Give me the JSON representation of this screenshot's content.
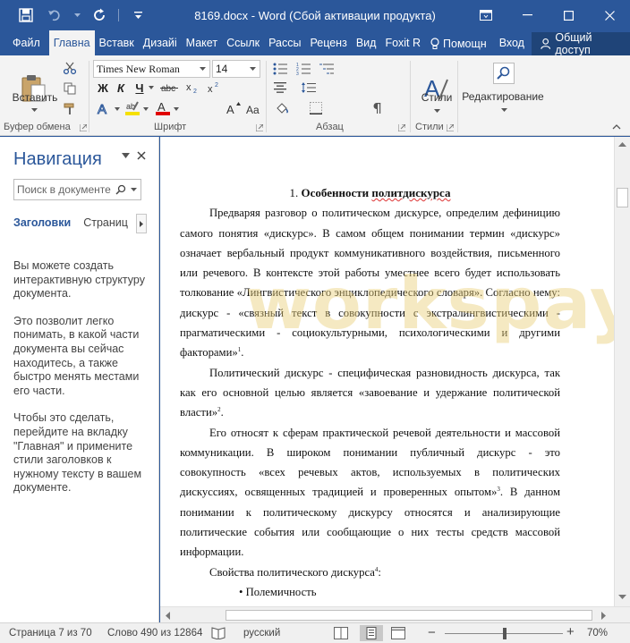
{
  "window": {
    "title": "8169.docx - Word (Сбой активации продукта)"
  },
  "tabs": {
    "file": "Файл",
    "items": [
      "Главна",
      "Вставк",
      "Дизайі",
      "Макет",
      "Ссылк",
      "Рассы",
      "Реценз",
      "Вид",
      "Foxit R"
    ],
    "help": "Помощн",
    "signin": "Вход",
    "share": "Общий доступ"
  },
  "ribbon": {
    "font_name": "Times New Roman",
    "font_size": "14",
    "paste_label": "Вставить",
    "styles_label": "Стили",
    "editing_label": "Редактирование",
    "groups": {
      "clipboard": "Буфер обмена",
      "font": "Шрифт",
      "paragraph": "Абзац",
      "styles": "Стили"
    },
    "format_buttons": [
      "Ж",
      "К",
      "Ч"
    ],
    "colors": {
      "highlight": "#f5e000",
      "font_color": "#e00000"
    }
  },
  "navigation": {
    "title": "Навигация",
    "search_placeholder": "Поиск в документе",
    "tab_headings": "Заголовки",
    "tab_pages": "Страниц",
    "help": [
      "Вы можете создать интерактивную структуру документа.",
      "Это позволит легко понимать, в какой части документа вы сейчас находитесь, а также быстро менять местами его части.",
      "Чтобы это сделать, перейдите на вкладку \"Главная\" и примените стили заголовков к нужному тексту в вашем документе."
    ]
  },
  "document": {
    "watermark": "workspay.ru",
    "heading_number": "1. ",
    "heading_bold": "Особенности ",
    "heading_squiggle": "политдискурса",
    "paragraphs": [
      {
        "text": "Предваряя разговор о политическом дискурсе, определим дефиницию самого понятия «дискурс». В самом общем понимании термин «дискурс» означает вербальный продукт коммуникативного воздействия, письменного или речевого. В контексте этой работы уместнее всего будет использовать толкование «Лингвистического энциклопедического словаря». Согласно нему: дискурс - «связный текст в совокупности с экстралингвистическими - прагматическими - социокультурными, психологическими и другими факторами»",
        "fn": "1",
        "tail": "."
      },
      {
        "text": "Политический дискурс - специфическая разновидность дискурса, так как его основной целью является «завоевание и удержание политической власти»",
        "fn": "2",
        "tail": "."
      },
      {
        "text": "Его относят к сферам практической речевой деятельности и массовой коммуникации. В широком понимании публичный дискурс - это совокупность «всех речевых актов, используемых в политических дискуссиях, освященных традицией и проверенных опытом»",
        "fn": "3",
        "tail": ". В данном понимании к политическому дискурсу относятся и анализирующие политические события или сообщающие о них тесты средств массовой информации."
      },
      {
        "text": "Свойства политического дискурса",
        "fn": "4",
        "tail": ":"
      }
    ],
    "bullet": "Полемичность"
  },
  "status": {
    "page": "Страница 7 из 70",
    "words": "Слово 490 из 12864",
    "language": "русский",
    "zoom": "70%",
    "zoom_minus": "−",
    "zoom_plus": "+"
  }
}
